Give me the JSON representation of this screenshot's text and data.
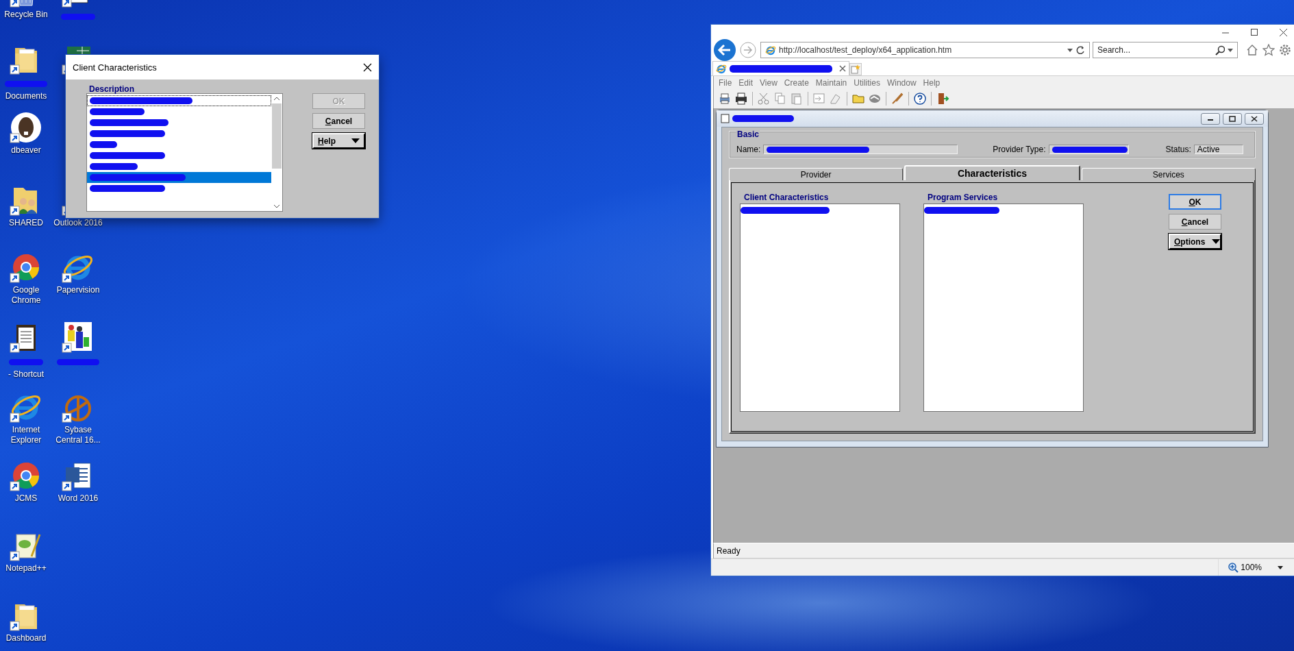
{
  "desktop_icons": [
    {
      "kind": "recycle-bin",
      "label": "Recycle Bin",
      "redacted": false
    },
    {
      "kind": "book",
      "redacted": true
    },
    {
      "kind": "folder",
      "label": "Documents",
      "redacted": true
    },
    {
      "kind": "spreadsheet",
      "redacted": false
    },
    {
      "kind": "beaver",
      "label": "dbeaver",
      "redacted": false
    },
    {
      "kind": "shared-folder",
      "label": "SHARED",
      "redacted": false
    },
    {
      "kind": "mail",
      "label": "Outlook 2016",
      "redacted": false
    },
    {
      "kind": "chrome",
      "label": "Google Chrome",
      "redacted": false
    },
    {
      "kind": "ie",
      "label": "Papervision",
      "redacted": false
    },
    {
      "kind": "clipboard",
      "label": "- Shortcut",
      "redacted": true
    },
    {
      "kind": "people",
      "redacted": true
    },
    {
      "kind": "ie",
      "label": "Internet Explorer",
      "redacted": false
    },
    {
      "kind": "wheel",
      "label": "Sybase Central 16...",
      "redacted": false
    },
    {
      "kind": "chrome",
      "label": "JCMS",
      "redacted": false
    },
    {
      "kind": "word",
      "label": "Word 2016",
      "redacted": false
    },
    {
      "kind": "notepad",
      "label": "Notepad++",
      "redacted": false
    },
    {
      "kind": "folder",
      "label": "Dashboard",
      "redacted": false
    }
  ],
  "dialog": {
    "title": "Client Characteristics",
    "list_heading": "Description",
    "rows": [
      {
        "focused": true,
        "selected": false,
        "redacted": true
      },
      {
        "focused": false,
        "selected": false,
        "redacted": true
      },
      {
        "focused": false,
        "selected": false,
        "redacted": true
      },
      {
        "focused": false,
        "selected": false,
        "redacted": true
      },
      {
        "focused": false,
        "selected": false,
        "redacted": true
      },
      {
        "focused": false,
        "selected": false,
        "redacted": true
      },
      {
        "focused": false,
        "selected": false,
        "redacted": true
      },
      {
        "focused": false,
        "selected": true,
        "redacted": true
      },
      {
        "focused": false,
        "selected": false,
        "redacted": true
      }
    ],
    "buttons": [
      {
        "label": "OK",
        "kind": "plain",
        "disabled": true
      },
      {
        "label": "Cancel",
        "kind": "plain",
        "disabled": false
      },
      {
        "label": "Help",
        "kind": "menu",
        "disabled": false
      }
    ]
  },
  "browser": {
    "address": "http://localhost/test_deploy/x64_application.htm",
    "search": {
      "placeholder": "Search..."
    },
    "tab": {
      "redacted": true
    },
    "menu": [
      "File",
      "Edit",
      "View",
      "Create",
      "Maintain",
      "Utilities",
      "Window",
      "Help"
    ],
    "app_window": {
      "redacted_title": true,
      "basic": {
        "title": "Basic",
        "fields": [
          {
            "label": "Name:",
            "redacted": true
          },
          {
            "label": "Provider Type:",
            "redacted": true
          },
          {
            "label": "Status:",
            "value": "Active",
            "redacted": false
          }
        ]
      },
      "tabs": [
        {
          "label": "Provider",
          "selected": false
        },
        {
          "label": "Characteristics",
          "selected": true
        },
        {
          "label": "Services",
          "selected": false
        }
      ],
      "lists": [
        {
          "title": "Client Characteristics",
          "rows": [
            {
              "selected": false,
              "redacted": true
            }
          ]
        },
        {
          "title": "Program Services",
          "rows": [
            {
              "selected": false,
              "redacted": true
            }
          ]
        }
      ],
      "buttons": [
        {
          "label": "OK",
          "kind": "default",
          "disabled": false
        },
        {
          "label": "Cancel",
          "kind": "plain",
          "disabled": false
        },
        {
          "label": "Options",
          "kind": "menu",
          "disabled": false
        }
      ]
    },
    "status": "Ready",
    "zoom": "100%"
  }
}
